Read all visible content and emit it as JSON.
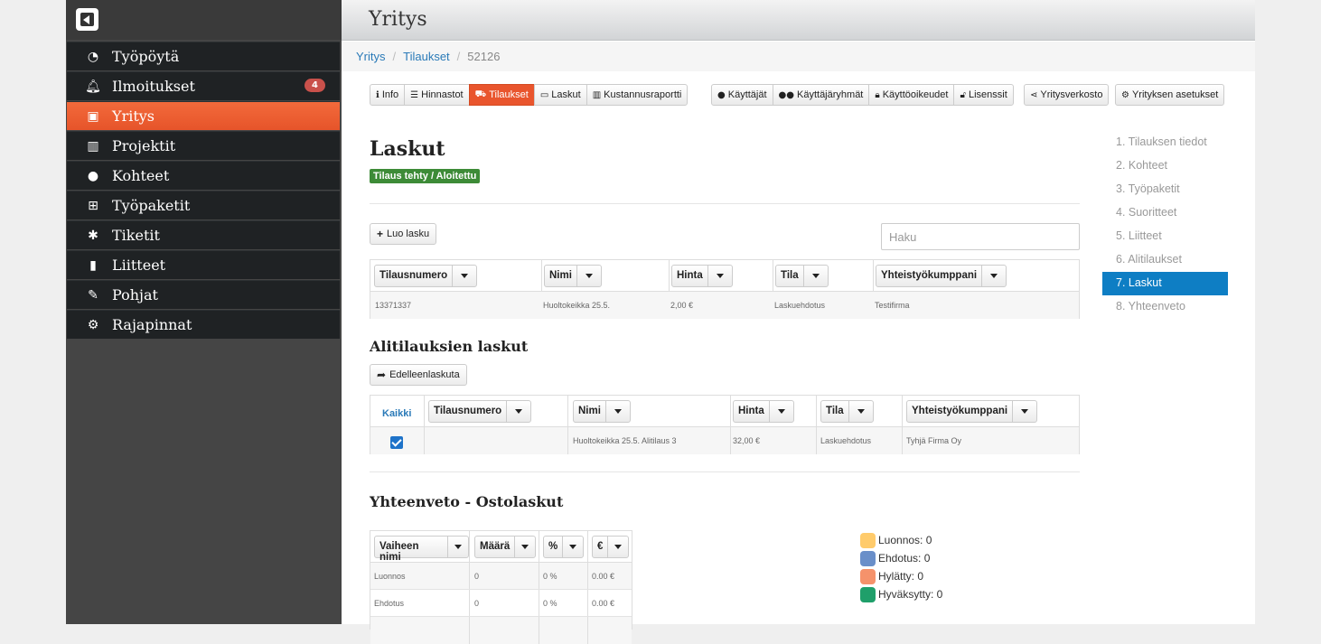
{
  "sidebar": {
    "items": [
      {
        "label": "Työpöytä",
        "icon": "dashboard-icon"
      },
      {
        "label": "Ilmoitukset",
        "icon": "bell-icon",
        "badge": "4"
      },
      {
        "label": "Yritys",
        "icon": "briefcase-icon",
        "active": true
      },
      {
        "label": "Projektit",
        "icon": "bar-chart-icon"
      },
      {
        "label": "Kohteet",
        "icon": "map-marker-icon"
      },
      {
        "label": "Työpaketit",
        "icon": "sitemap-icon"
      },
      {
        "label": "Tiketit",
        "icon": "bug-icon"
      },
      {
        "label": "Liitteet",
        "icon": "file-icon"
      },
      {
        "label": "Pohjat",
        "icon": "pencil-icon"
      },
      {
        "label": "Rajapinnat",
        "icon": "cogs-icon"
      }
    ]
  },
  "header": {
    "title": "Yritys"
  },
  "breadcrumb": {
    "items": [
      "Yritys",
      "Tilaukset"
    ],
    "current": "52126"
  },
  "toolbar": {
    "group1": [
      "Info",
      "Hinnastot",
      "Tilaukset",
      "Laskut",
      "Kustannusraportti"
    ],
    "group2": [
      "Käyttäjät",
      "Käyttäjäryhmät",
      "Käyttöoikeudet",
      "Lisenssit"
    ],
    "group3": [
      "Yritysverkosto"
    ],
    "group4": [
      "Yrityksen asetukset"
    ]
  },
  "main": {
    "title": "Laskut",
    "status": "Tilaus tehty / Aloitettu",
    "create_button": "Luo lasku",
    "search_placeholder": "Haku",
    "invoices": {
      "columns": [
        "Tilausnumero",
        "Nimi",
        "Hinta",
        "Tila",
        "Yhteistyökumppani"
      ],
      "rows": [
        [
          "13371337",
          "Huoltokeikka 25.5.",
          "2,00 €",
          "Laskuehdotus",
          "Testifirma"
        ]
      ]
    },
    "sub_title": "Alitilauksien laskut",
    "forward_button": "Edelleenlaskuta",
    "sub_invoices": {
      "select_all": "Kaikki",
      "columns": [
        "Tilausnumero",
        "Nimi",
        "Hinta",
        "Tila",
        "Yhteistyökumppani"
      ],
      "rows": [
        [
          "",
          "Huoltokeikka 25.5. Alitilaus 3",
          "32,00 €",
          "Laskuehdotus",
          "Tyhjä Firma Oy"
        ]
      ]
    },
    "summary_title": "Yhteenveto - Ostolaskut",
    "summary": {
      "columns": [
        "Vaiheen nimi",
        "Määrä",
        "%",
        "€"
      ],
      "rows": [
        [
          "Luonnos",
          "0",
          "0 %",
          "0.00 €"
        ],
        [
          "Ehdotus",
          "0",
          "0 %",
          "0.00 €"
        ]
      ]
    },
    "legend": [
      {
        "label": "Luonnos: 0",
        "color": "#ffcb6b"
      },
      {
        "label": "Ehdotus: 0",
        "color": "#6a8fc9"
      },
      {
        "label": "Hylätty: 0",
        "color": "#f5926b"
      },
      {
        "label": "Hyväksytty: 0",
        "color": "#1f9f6a"
      }
    ]
  },
  "steps": [
    "1. Tilauksen tiedot",
    "2. Kohteet",
    "3. Työpaketit",
    "4. Suoritteet",
    "5. Liitteet",
    "6. Alitilaukset",
    "7. Laskut",
    "8. Yhteenveto"
  ]
}
